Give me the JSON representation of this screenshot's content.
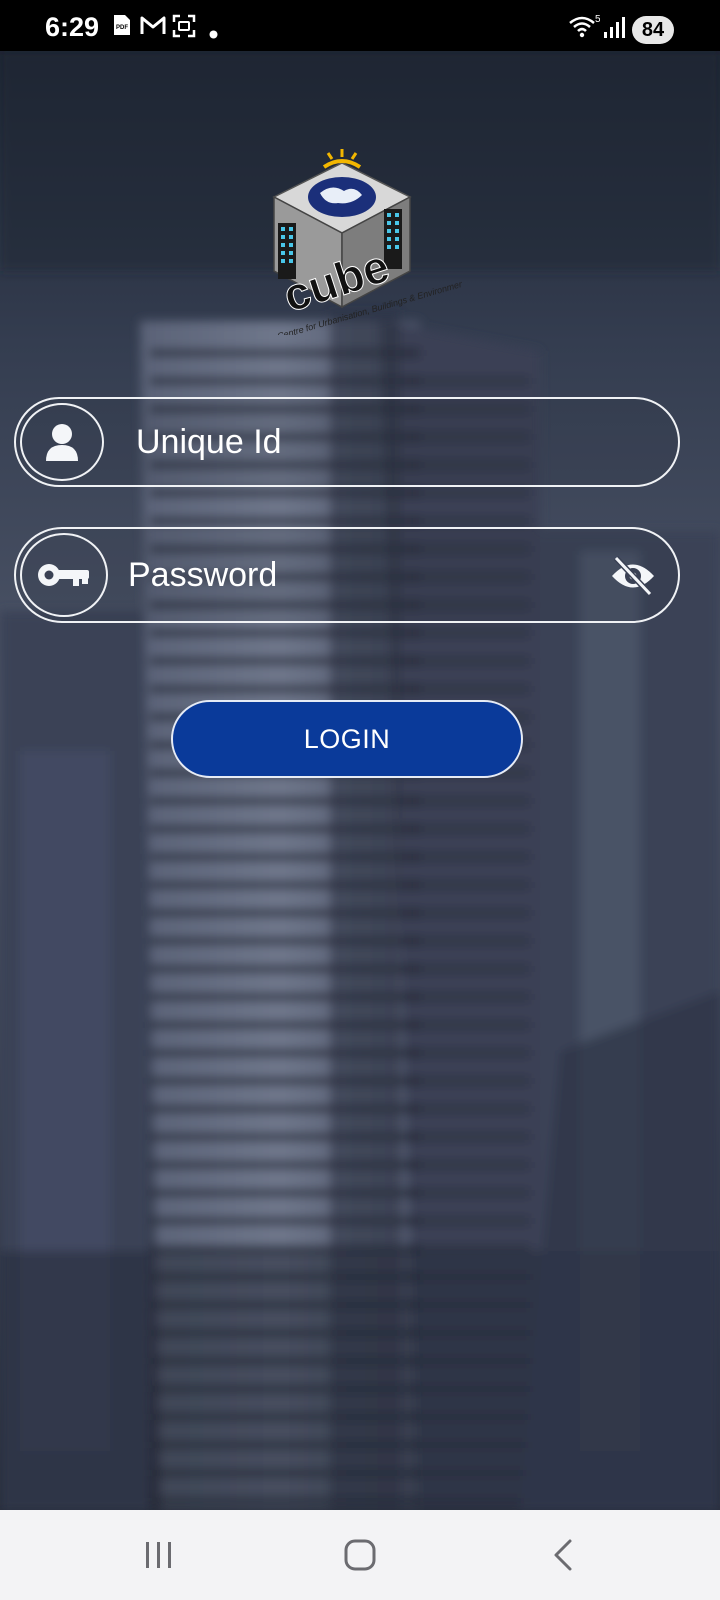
{
  "status_bar": {
    "time": "6:29",
    "icons": [
      "pdf-icon",
      "gmail-icon",
      "screenshot-icon",
      "notification-dot-icon",
      "wifi-icon",
      "signal-icon"
    ],
    "wifi_label": "5",
    "battery": "84"
  },
  "logo": {
    "icon": "cube-logo-icon",
    "wordmark": "cube",
    "tagline": "Centre for Urbanisation, Buildings & Environment"
  },
  "form": {
    "unique_id": {
      "placeholder": "Unique Id",
      "icon": "user-icon"
    },
    "password": {
      "placeholder": "Password",
      "icon": "key-icon",
      "toggle_icon": "eye-off-icon"
    },
    "login_label": "LOGIN"
  },
  "colors": {
    "accent": "#0a3a9a",
    "field_border": "#f0f2f5",
    "status_bar": "#000000",
    "nav_bar": "#f3f3f5"
  },
  "nav_bar": {
    "icons": [
      "recent-apps-icon",
      "home-icon",
      "back-icon"
    ]
  }
}
